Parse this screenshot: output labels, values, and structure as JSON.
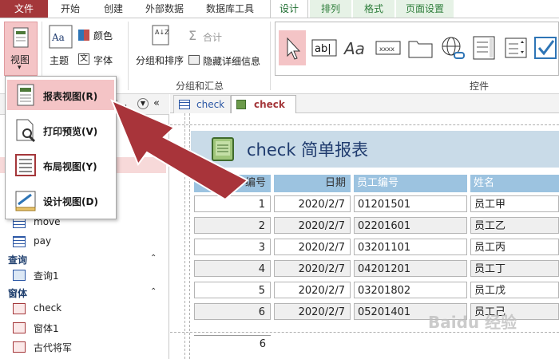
{
  "ribbon_tabs": [
    "文件",
    "开始",
    "创建",
    "外部数据",
    "数据库工具",
    "设计",
    "排列",
    "格式",
    "页面设置"
  ],
  "ribbon": {
    "view_label": "视图",
    "theme_label": "主题",
    "colors_label": "颜色",
    "font_label": "字体",
    "group_sort_label": "分组和排序",
    "totals_label": "合计",
    "hide_details_label": "隐藏详细信息",
    "group_group_label": "分组和汇总",
    "controls_group_label": "控件",
    "textbox_glyph": "ab|",
    "label_glyph": "Aa",
    "xxxx_glyph": "xxxx",
    "az_glyph": "A↓Z"
  },
  "view_menu": [
    {
      "label": "报表视图(R)",
      "icon": "report-view-icon",
      "highlighted": true
    },
    {
      "label": "打印预览(V)",
      "icon": "print-preview-icon",
      "highlighted": false
    },
    {
      "label": "布局视图(Y)",
      "icon": "layout-view-icon",
      "highlighted": false
    },
    {
      "label": "设计视图(D)",
      "icon": "design-view-icon",
      "highlighted": false
    }
  ],
  "nav": {
    "header_fragment": "t...",
    "tables": [
      "move",
      "pay"
    ],
    "queries_section": "查询",
    "queries": [
      "查询1"
    ],
    "forms_section": "窗体",
    "forms": [
      "check",
      "窗体1",
      "古代将军"
    ]
  },
  "doc_tabs": [
    {
      "label": "check",
      "active": false
    },
    {
      "label": "check",
      "active": true
    }
  ],
  "report": {
    "title": "check  简单报表",
    "columns": [
      "编号",
      "日期",
      "员工编号",
      "姓名"
    ],
    "rows": [
      [
        "1",
        "2020/2/7",
        "01201501",
        "员工甲"
      ],
      [
        "2",
        "2020/2/7",
        "02201601",
        "员工乙"
      ],
      [
        "3",
        "2020/2/7",
        "03201101",
        "员工丙"
      ],
      [
        "4",
        "2020/2/7",
        "04201201",
        "员工丁"
      ],
      [
        "5",
        "2020/2/7",
        "03201802",
        "员工戊"
      ],
      [
        "6",
        "2020/2/7",
        "05201401",
        "员工己"
      ]
    ],
    "footer_count": "6"
  },
  "watermark": "Baidu 经验",
  "colors": {
    "accent": "#a4373a",
    "header_band": "#c9dbe8",
    "col_header": "#9cc3e0",
    "highlight": "#f4c4c6",
    "arrow": "#a8343a"
  }
}
